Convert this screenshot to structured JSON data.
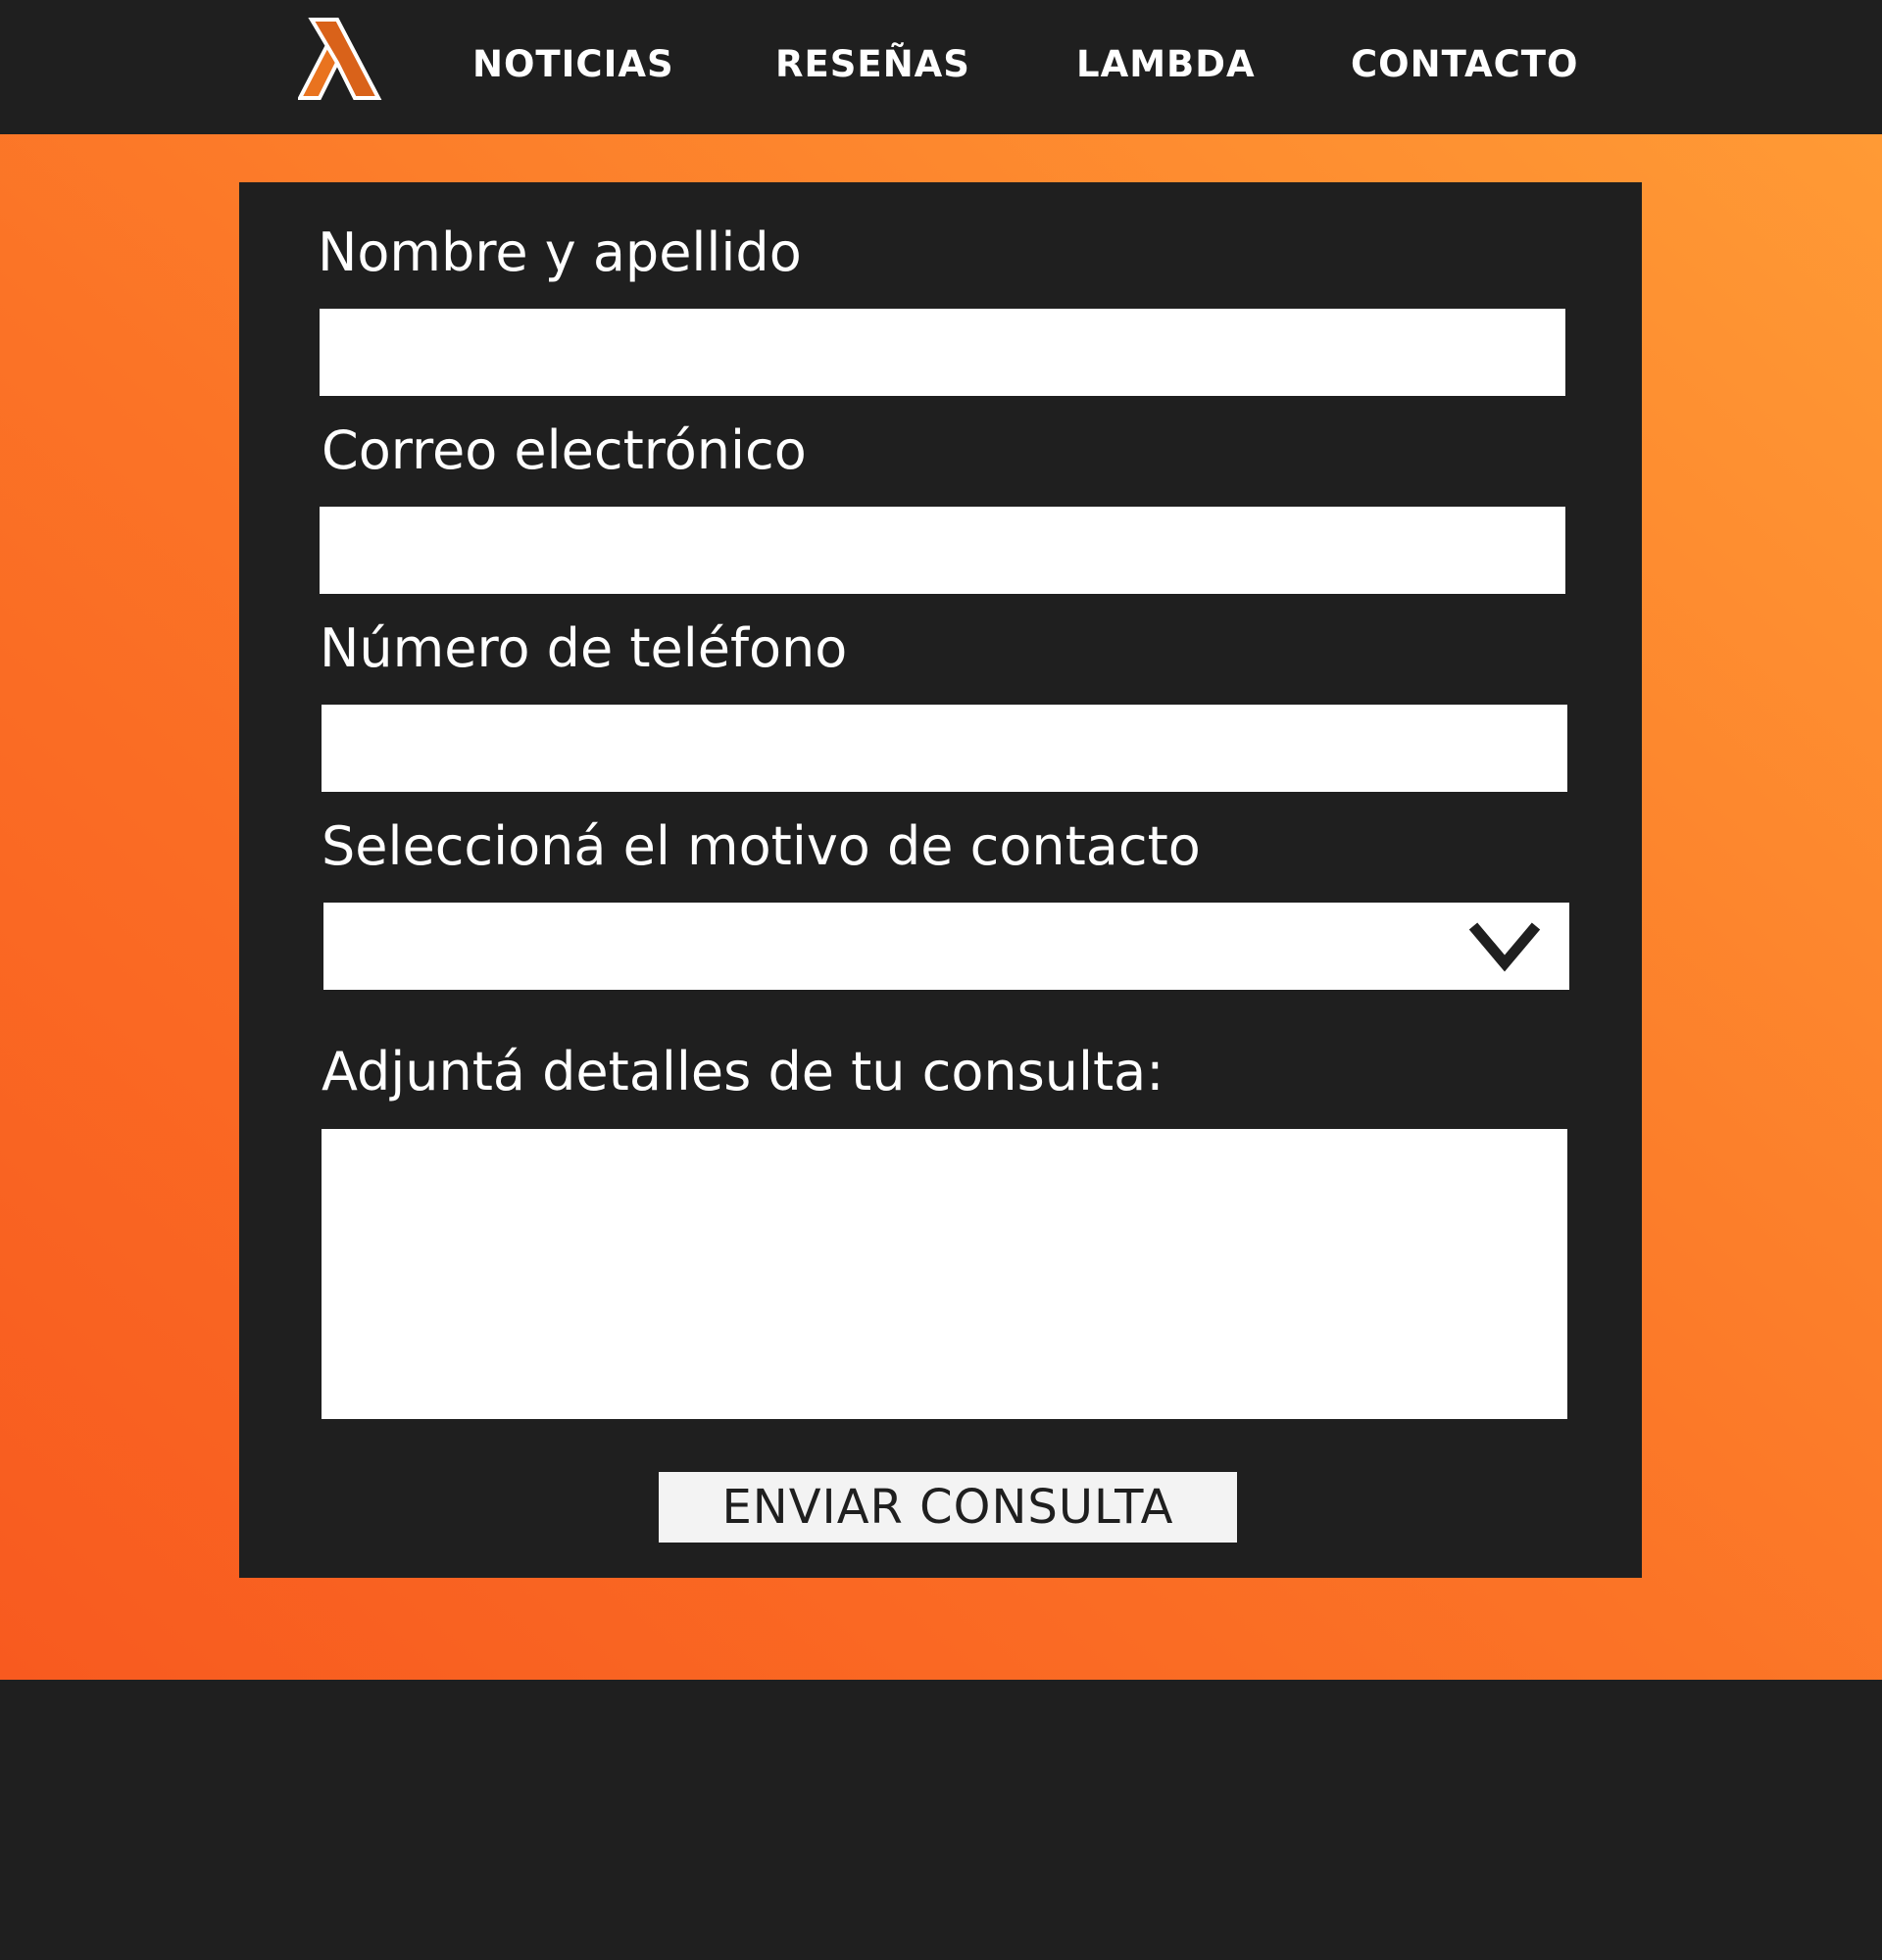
{
  "nav": {
    "logo_icon": "lambda-logo-icon",
    "links": [
      {
        "label": "NOTICIAS"
      },
      {
        "label": "RESEÑAS"
      },
      {
        "label": "LAMBDA"
      },
      {
        "label": "CONTACTO"
      }
    ]
  },
  "form": {
    "name": {
      "label": "Nombre y apellido",
      "value": ""
    },
    "email": {
      "label": "Correo electrónico",
      "value": ""
    },
    "phone": {
      "label": "Número de teléfono",
      "value": ""
    },
    "reason": {
      "label": "Seleccioná el motivo de contacto",
      "selected": "",
      "icon": "chevron-down-icon"
    },
    "details": {
      "label": "Adjuntá detalles de tu consulta:",
      "value": ""
    },
    "submit_label": "ENVIAR CONSULTA"
  },
  "colors": {
    "accent_orange": "#fb7326",
    "accent_orange_light": "#ff9a35",
    "accent_orange_dark": "#f85a1f",
    "dark": "#1f1f1f",
    "white": "#ffffff"
  }
}
